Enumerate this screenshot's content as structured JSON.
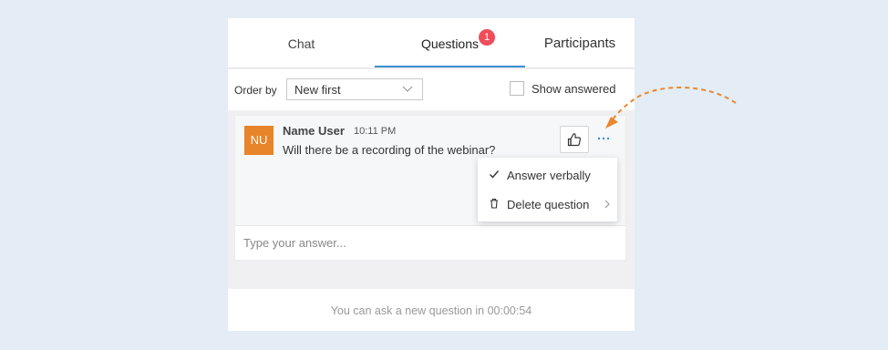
{
  "colors": {
    "accent": "#3a8fd4",
    "badge": "#ee4d5a",
    "avatar": "#e8842a",
    "annotation": "#e8882e",
    "background": "#e4ecf5"
  },
  "tabs": [
    {
      "label": "Chat"
    },
    {
      "label": "Questions",
      "active": true,
      "badge": "1"
    },
    {
      "label": "Participants"
    }
  ],
  "filter": {
    "order_label": "Order by",
    "order_value": "New first",
    "show_answered_label": "Show answered",
    "show_answered_checked": false
  },
  "question": {
    "avatar_initials": "NU",
    "author": "Name User",
    "time": "10:11 PM",
    "text": "Will there be a recording of the webinar?",
    "like_icon": "thumbs-up-icon",
    "more_icon": "ellipsis-icon"
  },
  "answer": {
    "placeholder": "Type your answer..."
  },
  "menu": {
    "items": [
      {
        "label": "Answer verbally",
        "icon": "check-icon"
      },
      {
        "label": "Delete question",
        "icon": "trash-icon",
        "submenu_icon": "chevron-right-icon"
      }
    ]
  },
  "footer": {
    "text": "You can ask a new question in 00:00:54"
  }
}
